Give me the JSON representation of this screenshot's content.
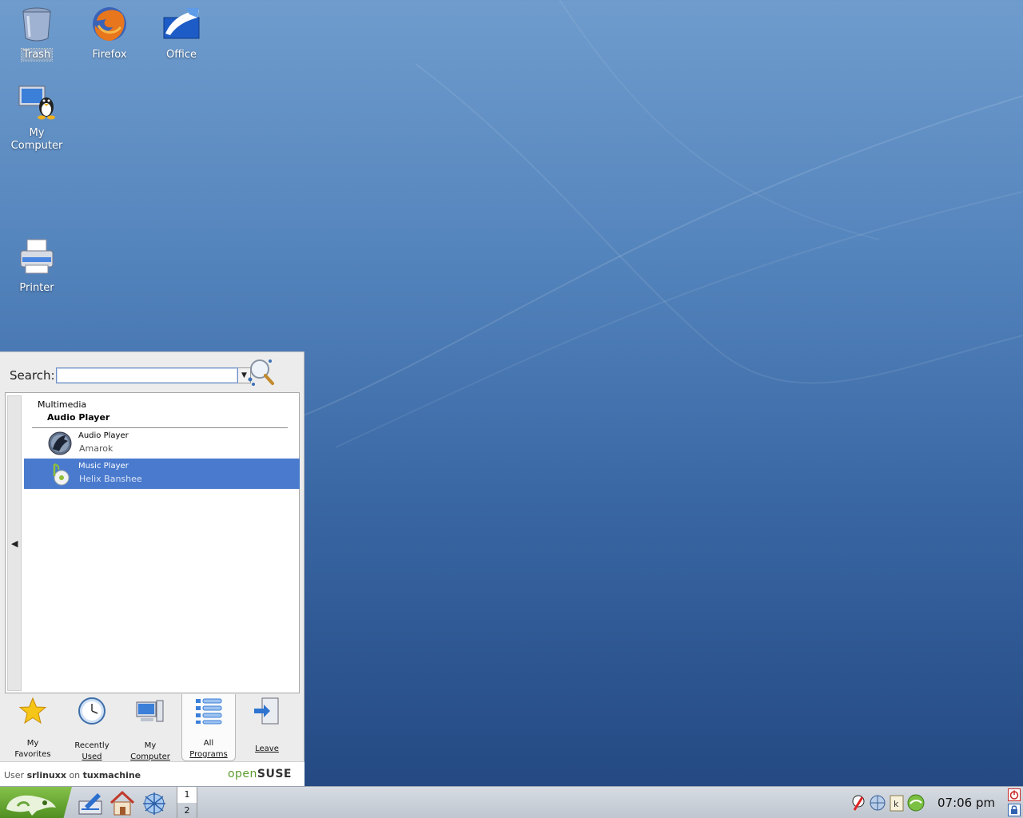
{
  "desktop": {
    "icons": [
      {
        "id": "trash",
        "label": "Trash"
      },
      {
        "id": "firefox",
        "label": "Firefox"
      },
      {
        "id": "office",
        "label": "Office"
      },
      {
        "id": "my-computer",
        "label": "My Computer"
      },
      {
        "id": "printer",
        "label": "Printer"
      }
    ]
  },
  "kickoff": {
    "search": {
      "label": "Search:",
      "value": ""
    },
    "breadcrumb": {
      "parent": "Multimedia",
      "current": "Audio Player"
    },
    "items": [
      {
        "name": "Audio Player",
        "desc": "Amarok",
        "icon": "amarok-icon",
        "selected": false
      },
      {
        "name": "Music Player",
        "desc": "Helix Banshee",
        "icon": "banshee-icon",
        "selected": true
      }
    ],
    "tabs": [
      {
        "line1": "My",
        "line2": "Favorites",
        "icon": "star-icon"
      },
      {
        "line1": "Recently",
        "line2": "Used",
        "icon": "clock-icon"
      },
      {
        "line1": "My",
        "line2": "Computer",
        "icon": "computer-icon"
      },
      {
        "line1": "All",
        "line2": "Programs",
        "icon": "list-icon",
        "active": true
      },
      {
        "line1": "Leave",
        "line2": "",
        "icon": "exit-icon"
      }
    ],
    "userbar": {
      "prefix": "User",
      "user": "srlinuxx",
      "on": "on",
      "host": "tuxmachine",
      "brand_a": "open",
      "brand_b": "SUSE"
    }
  },
  "taskbar": {
    "pager": [
      "1",
      "2"
    ],
    "clock": "07:06 pm"
  },
  "colors": {
    "accent": "#4a7acd",
    "suse_green": "#5a9a2b"
  }
}
